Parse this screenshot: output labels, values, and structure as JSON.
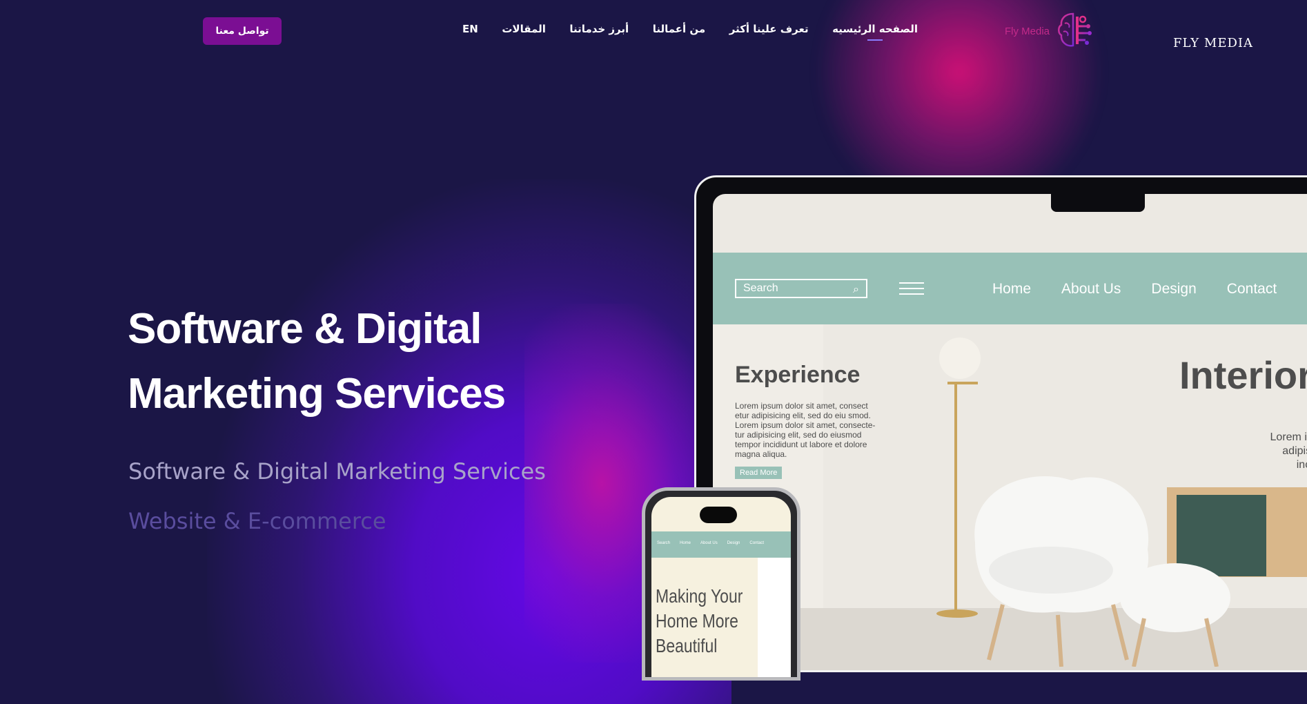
{
  "brand": {
    "name": "FLY MEDIA",
    "logo_text": "Fly Media",
    "logo_icon": "brain-circuit-icon"
  },
  "nav": {
    "items": [
      {
        "label": "الصفحه الرئيسيه",
        "active": true
      },
      {
        "label": "تعرف علينا أكثر",
        "active": false
      },
      {
        "label": "من أعمالنا",
        "active": false
      },
      {
        "label": "أبرز خدماتنا",
        "active": false
      },
      {
        "label": "المقالات",
        "active": false
      },
      {
        "label": "EN",
        "active": false
      }
    ],
    "contact_label": "تواصل معنا"
  },
  "hero": {
    "title_line1": "Software & Digital",
    "title_line2": "Marketing Services",
    "subtitle1": "Software & Digital Marketing Services",
    "subtitle2": "Website & E-commerce"
  },
  "mockup": {
    "search_placeholder": "Search",
    "links": [
      "Home",
      "About Us",
      "Design",
      "Contact"
    ],
    "experience_title": "Experience",
    "experience_body": "Lorem ipsum dolor sit amet, consect etur adipisicing elit, sed do eiu smod. Lorem ipsum dolor sit amet, consecte-tur adipisicing elit, sed do eiusmod tempor incididunt ut labore et dolore magna aliqua.",
    "read_more": "Read More",
    "interior_title": "Interior",
    "interior_body_line1": "Lorem ipsum",
    "interior_body_line2": "adipisicing",
    "interior_body_line3": "incididu",
    "phone_heading": "Making Your Home More Beautiful"
  },
  "colors": {
    "background": "#1b1646",
    "contact_button": "#7b0e93",
    "glow_pink": "#d61078",
    "glow_purple": "#6408e6",
    "mockup_accent": "#98c1b7"
  }
}
